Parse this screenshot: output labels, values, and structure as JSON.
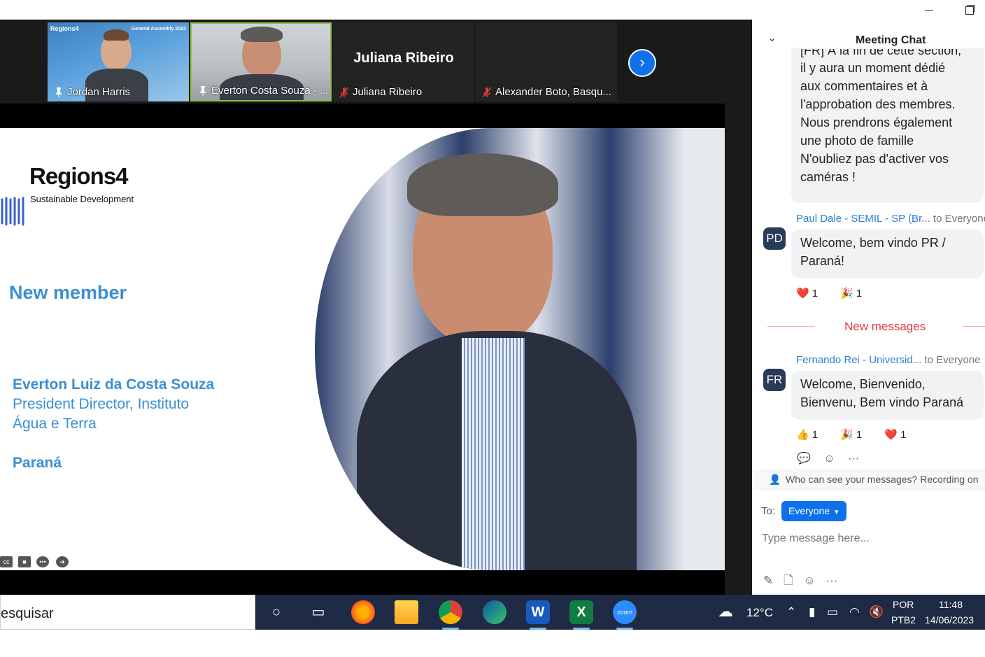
{
  "window": {
    "minimize_icon": "minimize-icon",
    "restore_icon": "restore-icon"
  },
  "participants": [
    {
      "name": "Jordan Harris",
      "status": "pinned",
      "video": true
    },
    {
      "name": "Everton Costa Souza - ...",
      "status": "pinned",
      "video": true,
      "speaking": true
    },
    {
      "name": "Juliana Ribeiro",
      "display_name": "Juliana Ribeiro",
      "status": "muted",
      "video": false
    },
    {
      "name": "Alexander Boto, Basqu...",
      "status": "muted",
      "video": false
    }
  ],
  "tile1_overlay": {
    "logo": "Regions4",
    "event": "General Assembly 2023"
  },
  "slide": {
    "logo_name": "Regions4",
    "logo_sub": "Sustainable Development",
    "heading": "New member",
    "person_name": "Everton Luiz da Costa Souza",
    "role_line1": "President Director, Instituto",
    "role_line2": "Água e Terra",
    "region": "Paraná",
    "accent_color": "#3b8fd3",
    "controls": [
      "cc-icon",
      "camera-icon",
      "more-icon",
      "arrow-right-icon"
    ]
  },
  "chat": {
    "title": "Meeting Chat",
    "messages": [
      {
        "text_lines": [
          "[FR] À la fin de cette section,",
          "il y aura un moment dédié",
          "aux commentaires et à",
          "l'approbation des membres.",
          "Nous prendrons également",
          "une photo de famille",
          "N'oubliez pas d'activer vos",
          "caméras !"
        ]
      },
      {
        "sender": "Paul Dale - SEMIL - SP (Br...",
        "to": "to Everyone",
        "avatar": "PD",
        "text_lines": [
          "Welcome, bem vindo PR /",
          "Paraná!"
        ],
        "reactions": [
          {
            "emoji": "❤️",
            "count": "1"
          },
          {
            "emoji": "🎉",
            "count": "1"
          }
        ]
      },
      {
        "sender": "Fernando Rei - Universid...",
        "to": "to Everyone",
        "avatar": "FR",
        "text_lines": [
          "Welcome, Bienvenido,",
          "Bienvenu, Bem vindo Paraná"
        ],
        "reactions": [
          {
            "emoji": "👍",
            "count": "1"
          },
          {
            "emoji": "🎉",
            "count": "1"
          },
          {
            "emoji": "❤️",
            "count": "1"
          }
        ]
      }
    ],
    "new_messages_label": "New messages",
    "who_can_see": "Who can see your messages? Recording on",
    "to_label": "To:",
    "recipient": "Everyone",
    "input_placeholder": "Type message here..."
  },
  "taskbar": {
    "search_text": "esquisar",
    "apps": [
      "cortana-icon",
      "task-view-icon",
      "firefox-icon",
      "file-explorer-icon",
      "chrome-icon",
      "edge-icon",
      "word-icon",
      "excel-icon",
      "zoom-icon"
    ],
    "weather_temp": "12°C",
    "lang_line1": "POR",
    "lang_line2": "PTB2",
    "time": "11:48",
    "date": "14/06/2023"
  }
}
